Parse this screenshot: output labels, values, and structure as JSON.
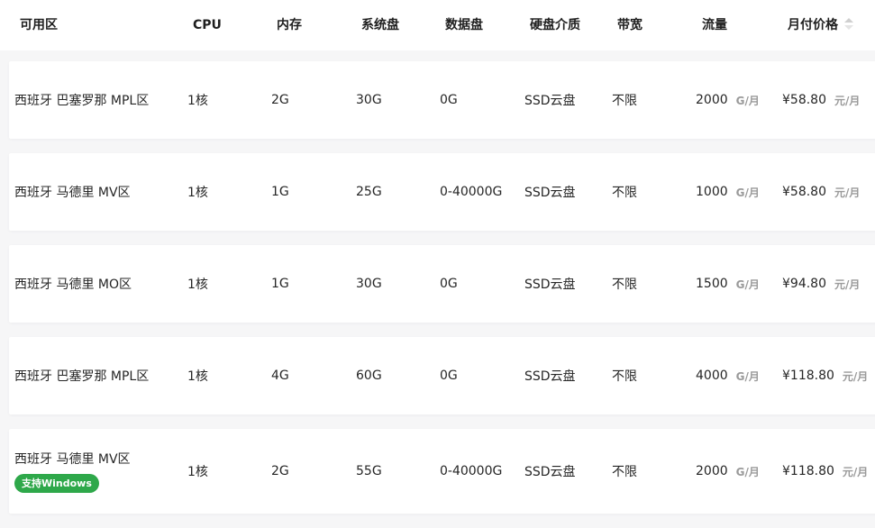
{
  "headers": {
    "zone": "可用区",
    "cpu": "CPU",
    "memory": "内存",
    "system_disk": "系统盘",
    "data_disk": "数据盘",
    "disk_type": "硬盘介质",
    "bandwidth": "带宽",
    "traffic": "流量",
    "monthly_price": "月付价格"
  },
  "colors": {
    "badge_green": "#2ea84a",
    "unit_gray": "#9a9a9a",
    "sort_icon": "#cfcfcf"
  },
  "icons": {
    "sort": "sort-caret-icon"
  },
  "rows": [
    {
      "zone": "西班牙 巴塞罗那 MPL区",
      "badge": "",
      "cpu": "1核",
      "memory": "2G",
      "system_disk": "30G",
      "data_disk": "0G",
      "disk_type": "SSD云盘",
      "bandwidth": "不限",
      "traffic": "2000",
      "traffic_unit": "G/月",
      "price": "¥58.80",
      "price_unit": "元/月"
    },
    {
      "zone": "西班牙 马德里 MV区",
      "badge": "",
      "cpu": "1核",
      "memory": "1G",
      "system_disk": "25G",
      "data_disk": "0-40000G",
      "disk_type": "SSD云盘",
      "bandwidth": "不限",
      "traffic": "1000",
      "traffic_unit": "G/月",
      "price": "¥58.80",
      "price_unit": "元/月"
    },
    {
      "zone": "西班牙 马德里 MO区",
      "badge": "",
      "cpu": "1核",
      "memory": "1G",
      "system_disk": "30G",
      "data_disk": "0G",
      "disk_type": "SSD云盘",
      "bandwidth": "不限",
      "traffic": "1500",
      "traffic_unit": "G/月",
      "price": "¥94.80",
      "price_unit": "元/月"
    },
    {
      "zone": "西班牙 巴塞罗那 MPL区",
      "badge": "",
      "cpu": "1核",
      "memory": "4G",
      "system_disk": "60G",
      "data_disk": "0G",
      "disk_type": "SSD云盘",
      "bandwidth": "不限",
      "traffic": "4000",
      "traffic_unit": "G/月",
      "price": "¥118.80",
      "price_unit": "元/月"
    },
    {
      "zone": "西班牙 马德里 MV区",
      "badge": "支持Windows",
      "cpu": "1核",
      "memory": "2G",
      "system_disk": "55G",
      "data_disk": "0-40000G",
      "disk_type": "SSD云盘",
      "bandwidth": "不限",
      "traffic": "2000",
      "traffic_unit": "G/月",
      "price": "¥118.80",
      "price_unit": "元/月"
    }
  ]
}
